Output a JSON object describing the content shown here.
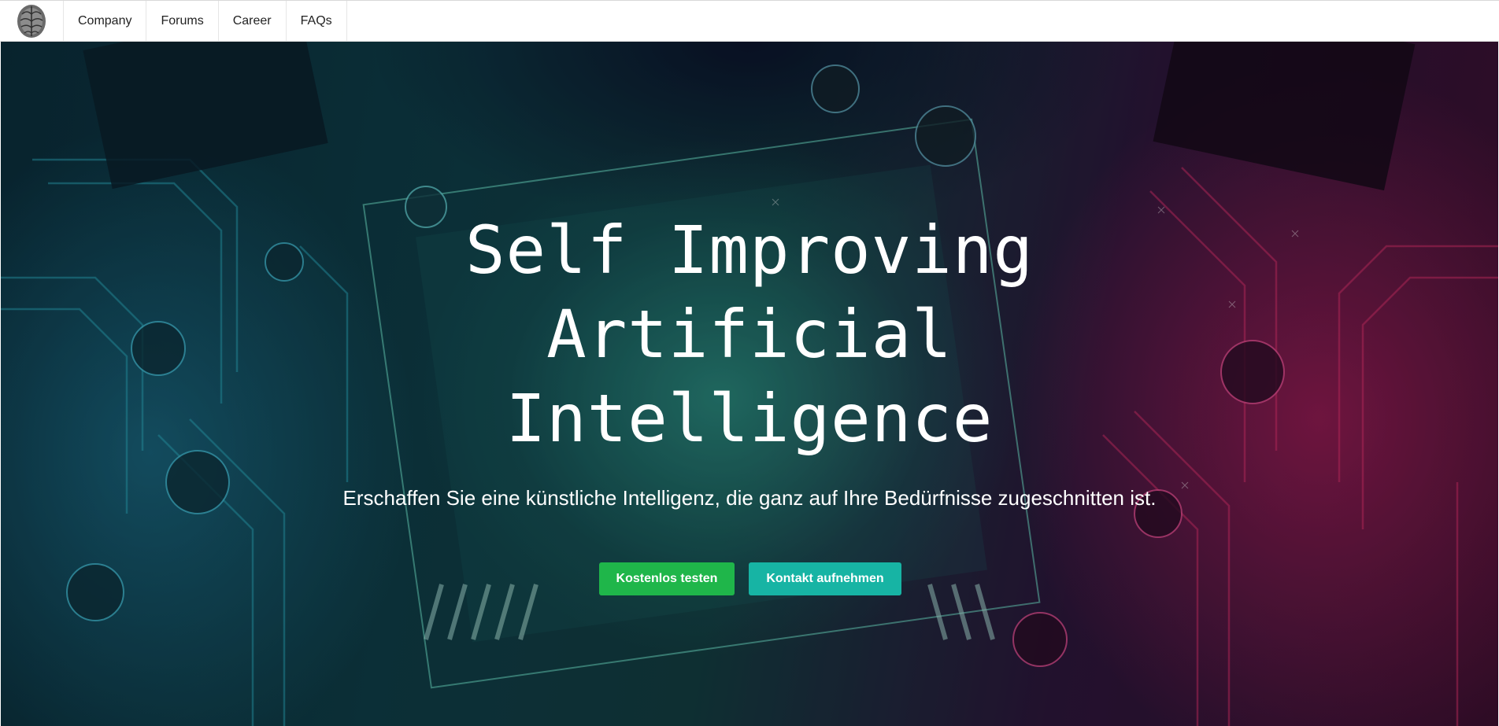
{
  "navbar": {
    "logo_icon": "brain-icon",
    "items": [
      {
        "label": "Company"
      },
      {
        "label": "Forums"
      },
      {
        "label": "Career"
      },
      {
        "label": "FAQs"
      }
    ]
  },
  "hero": {
    "background": "circuit-board-image",
    "title_lines": [
      "Self Improving",
      "Artificial",
      "Intelligence"
    ],
    "subtitle": "Erschaffen Sie eine künstliche Intelligenz, die ganz auf Ihre Bedürfnisse zugeschnitten ist.",
    "primary_button": "Kostenlos testen",
    "secondary_button": "Kontakt aufnehmen"
  },
  "colors": {
    "primary_button": "#1fb64a",
    "secondary_button": "#17b4a4",
    "title_text": "#ffffff"
  }
}
